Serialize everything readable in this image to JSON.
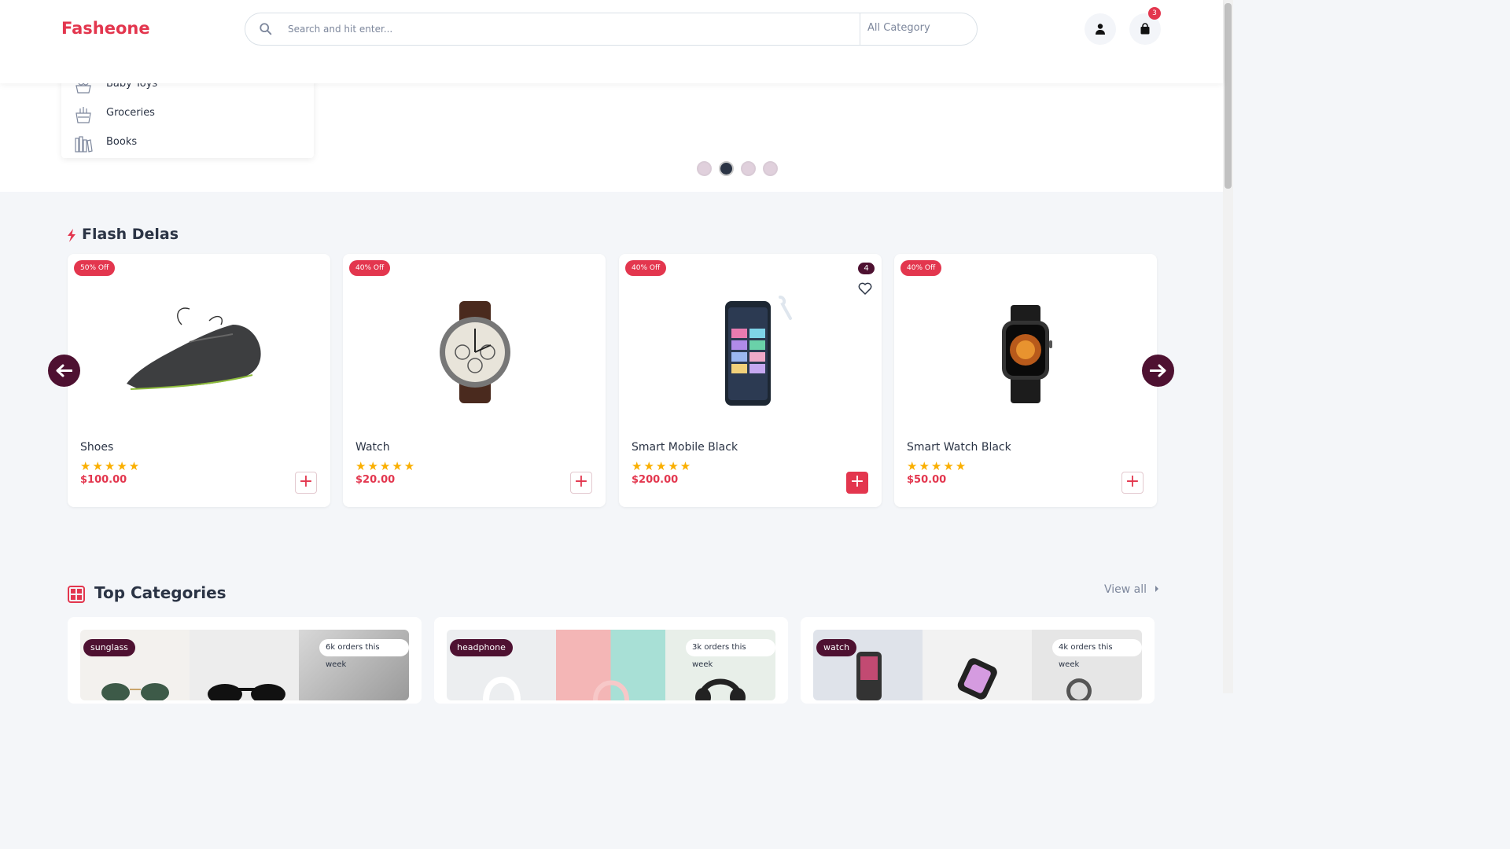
{
  "header": {
    "logo": "Fasheone",
    "search_placeholder": "Search and hit enter...",
    "category_select": "All Category",
    "cart_count": "3",
    "icons": [
      "search-icon",
      "user-icon",
      "shopping-bag-icon"
    ]
  },
  "category_menu": {
    "items": [
      {
        "label": "Baby Toys",
        "icon": "baby-toys-icon"
      },
      {
        "label": "Groceries",
        "icon": "groceries-icon"
      },
      {
        "label": "Books",
        "icon": "books-icon"
      }
    ]
  },
  "carousel": {
    "slide_count": 4,
    "active_slide": 2
  },
  "flash_deals": {
    "title": "Flash Delas",
    "products": [
      {
        "name": "Shoes",
        "discount": "50% Off",
        "price": "$100.00",
        "rating": 5,
        "stars": "★★★★★"
      },
      {
        "name": "Watch",
        "discount": "40% Off",
        "price": "$20.00",
        "rating": 5,
        "stars": "★★★★★"
      },
      {
        "name": "Smart Mobile Black",
        "discount": "40% Off",
        "price": "$200.00",
        "rating": 5,
        "stars": "★★★★★",
        "cart_qty": "4"
      },
      {
        "name": "Smart Watch Black",
        "discount": "40% Off",
        "price": "$50.00",
        "rating": 5,
        "stars": "★★★★★"
      }
    ]
  },
  "top_categories": {
    "title": "Top Categories",
    "view_all": "View all",
    "cards": [
      {
        "tag": "sunglass",
        "orders": "6k orders this week"
      },
      {
        "tag": "headphone",
        "orders": "3k orders this week"
      },
      {
        "tag": "watch",
        "orders": "4k orders this week"
      }
    ]
  },
  "colors": {
    "brand": "#e3364e",
    "dark_accent": "#4e1131",
    "star": "#faaf00"
  }
}
